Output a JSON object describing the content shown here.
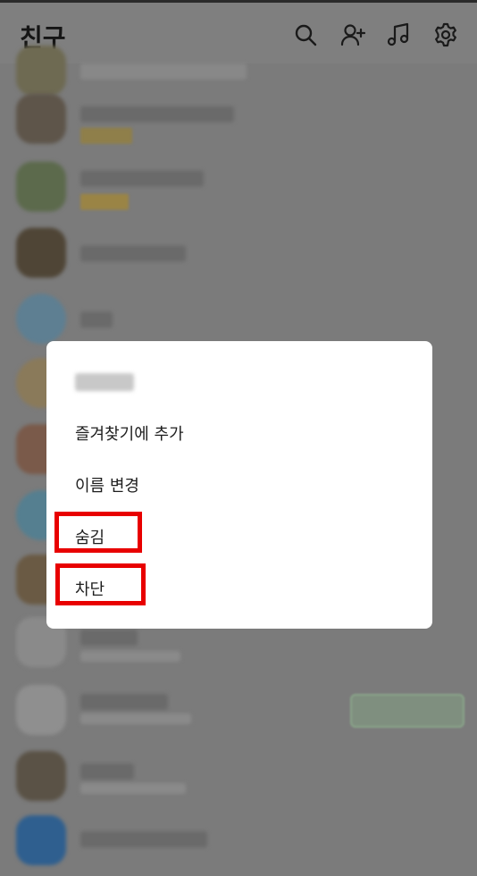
{
  "header": {
    "title": "친구",
    "icons": [
      "search-icon",
      "add-friend-icon",
      "music-icon",
      "settings-icon"
    ]
  },
  "dialog": {
    "menu_items": [
      {
        "label": "즐겨찾기에 추가"
      },
      {
        "label": "이름 변경"
      },
      {
        "label": "숨김"
      },
      {
        "label": "차단"
      }
    ]
  },
  "colors": {
    "overlay": "#7b7b7b",
    "dialog_bg": "#ffffff",
    "highlight": "#e80000",
    "text": "#1e1e1e"
  }
}
